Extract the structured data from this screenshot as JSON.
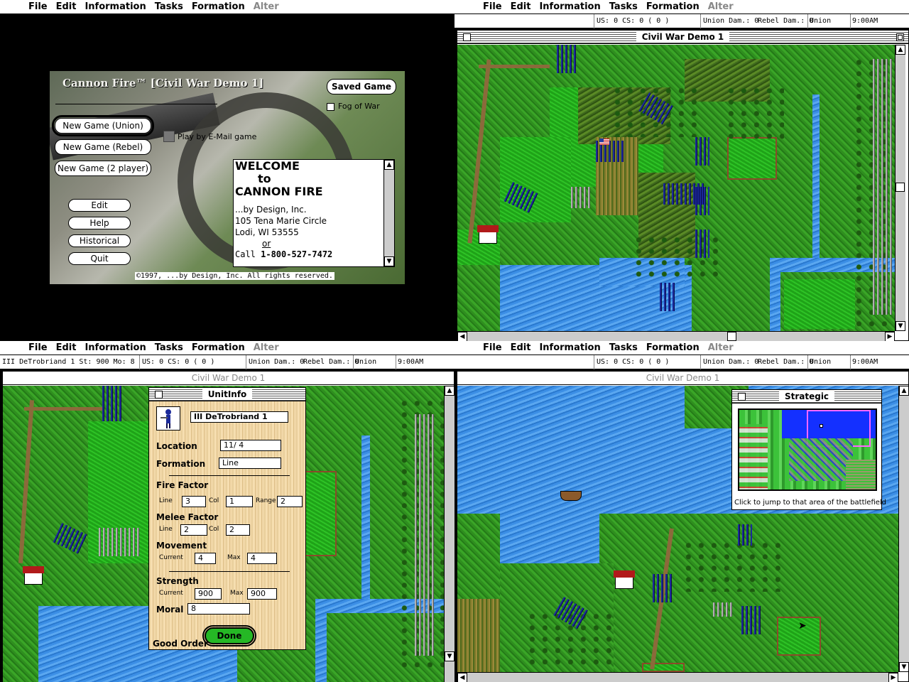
{
  "menu": {
    "apple": "",
    "items": [
      "File",
      "Edit",
      "Information",
      "Tasks",
      "Formation"
    ],
    "disabled_item": "Alter"
  },
  "status": {
    "us_cs": "US: 0 CS: 0  ( 0 )",
    "union_dam": "Union Dam.: 0",
    "rebel_dam": "Rebel Dam.: 0",
    "side": "Union",
    "time": "9:00AM",
    "unit_line": "III DeTrobriand 1  St: 900  Mo: 8"
  },
  "splash": {
    "title": "Cannon Fire™ [Civil War Demo 1]",
    "saved_game": "Saved Game",
    "fog_of_war": "Fog of War",
    "new_union": "New Game (Union)",
    "new_rebel": "New Game (Rebel)",
    "new_two": "New Game (2 player)",
    "email": "Play by E-Mail game",
    "edit": "Edit",
    "help": "Help",
    "historical": "Historical",
    "quit": "Quit",
    "welcome1": "WELCOME",
    "welcome2": "to",
    "welcome3": "CANNON FIRE",
    "addr1": "...by Design, Inc.",
    "addr2": "105 Tena Marie Circle",
    "addr3": "Lodi, WI 53555",
    "or": "or",
    "call_prefix": "Call ",
    "phone": "1-800-527-7472",
    "copyright": "©1997, ...by Design, Inc. All rights reserved."
  },
  "window_title": "Civil War Demo 1",
  "unitinfo": {
    "title": "UnitInfo",
    "name": "III DeTrobriand 1",
    "location_label": "Location",
    "location": "11/ 4",
    "formation_label": "Formation",
    "formation": "Line",
    "fire_label": "Fire Factor",
    "line_label": "Line",
    "col_label": "Col",
    "range_label": "Range",
    "fire_line": "3",
    "fire_col": "1",
    "fire_range": "2",
    "melee_label": "Melee Factor",
    "melee_line": "2",
    "melee_col": "2",
    "movement_label": "Movement",
    "current_label": "Current",
    "max_label": "Max",
    "move_current": "4",
    "move_max": "4",
    "strength_label": "Strength",
    "str_current": "900",
    "str_max": "900",
    "moral_label": "Moral",
    "moral": "8",
    "order": "Good Order",
    "done": "Done"
  },
  "strategic": {
    "title": "Strategic",
    "hint": "Click to jump to that area of the battlefield"
  },
  "colors": {
    "grass": "#2f8f1f",
    "water": "#3c8fe6",
    "union": "#1b2a9a",
    "done": "#25b825"
  }
}
